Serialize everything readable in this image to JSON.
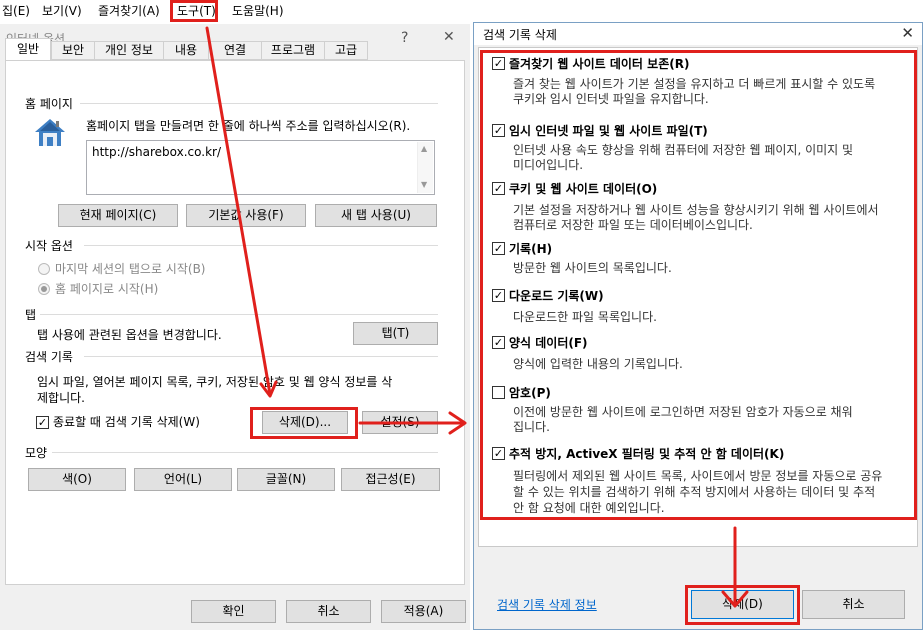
{
  "menubar": {
    "items": [
      "집(E)",
      "보기(V)",
      "즐겨찾기(A)",
      "도구(T)",
      "도움말(H)"
    ]
  },
  "options_dialog": {
    "title": "인터넷 옵션",
    "help_glyph": "?",
    "close_glyph": "✕",
    "tabs": [
      "일반",
      "보안",
      "개인 정보",
      "내용",
      "연결",
      "프로그램",
      "고급"
    ],
    "home": {
      "section": "홈 페이지",
      "description": "홈페이지 탭을 만들려면 한 줄에 하나씩 주소를 입력하십시오(R).",
      "url": "http://sharebox.co.kr/",
      "buttons": [
        "현재 페이지(C)",
        "기본값 사용(F)",
        "새 탭 사용(U)"
      ]
    },
    "startup": {
      "section": "시작 옵션",
      "options": [
        "마지막 세션의 탭으로 시작(B)",
        "홈 페이지로 시작(H)"
      ]
    },
    "tabs_section": {
      "section": "탭",
      "description": "탭 사용에 관련된 옵션을 변경합니다.",
      "button": "탭(T)"
    },
    "history": {
      "section": "검색 기록",
      "description_line1": "임시 파일, 열어본 페이지 목록, 쿠키, 저장된 암호 및 웹 양식 정보를 삭",
      "description_line2": "제합니다.",
      "checkbox": "종료할 때 검색 기록 삭제(W)",
      "delete_button": "삭제(D)...",
      "settings_button": "설정(S)"
    },
    "appearance": {
      "section": "모양",
      "buttons": [
        "색(O)",
        "언어(L)",
        "글꼴(N)",
        "접근성(E)"
      ]
    },
    "footer": [
      "확인",
      "취소",
      "적용(A)"
    ]
  },
  "delete_dialog": {
    "title": "검색 기록 삭제",
    "close_glyph": "✕",
    "items": [
      {
        "label": "즐겨찾기 웹 사이트 데이터 보존(R)",
        "checked": "✓",
        "desc": [
          "즐겨 찾는 웹 사이트가 기본 설정을 유지하고 더 빠르게 표시할 수 있도록",
          "쿠키와 임시 인터넷 파일을 유지합니다."
        ]
      },
      {
        "label": "임시 인터넷 파일 및 웹 사이트 파일(T)",
        "checked": "✓",
        "desc": [
          "인터넷 사용 속도 향상을 위해 컴퓨터에 저장한 웹 페이지, 이미지 및",
          "미디어입니다."
        ]
      },
      {
        "label": "쿠키 및 웹 사이트 데이터(O)",
        "checked": "✓",
        "desc": [
          "기본 설정을 저장하거나 웹 사이트 성능을 향상시키기 위해 웹 사이트에서",
          "컴퓨터로 저장한 파일 또는 데이터베이스입니다."
        ]
      },
      {
        "label": "기록(H)",
        "checked": "✓",
        "desc": [
          "방문한 웹 사이트의 목록입니다."
        ]
      },
      {
        "label": "다운로드 기록(W)",
        "checked": "✓",
        "desc": [
          "다운로드한 파일 목록입니다."
        ]
      },
      {
        "label": "양식 데이터(F)",
        "checked": "✓",
        "desc": [
          "양식에 입력한 내용의 기록입니다."
        ]
      },
      {
        "label": "암호(P)",
        "checked": "",
        "desc": [
          "이전에 방문한 웹 사이트에 로그인하면 저장된 암호가 자동으로 채워",
          "집니다."
        ]
      },
      {
        "label": "추적 방지, ActiveX 필터링 및 추적 안 함 데이터(K)",
        "checked": "✓",
        "desc": [
          "필터링에서 제외된 웹 사이트 목록, 사이트에서 방문 정보를 자동으로 공유",
          "할 수 있는 위치를 검색하기 위해 추적 방지에서 사용하는 데이터 및 추적",
          "안 함 요청에 대한 예외입니다."
        ]
      }
    ],
    "info_link": "검색 기록 삭제 정보",
    "delete_button": "삭제(D)",
    "cancel_button": "취소"
  },
  "annotation_color": "#e0201c"
}
